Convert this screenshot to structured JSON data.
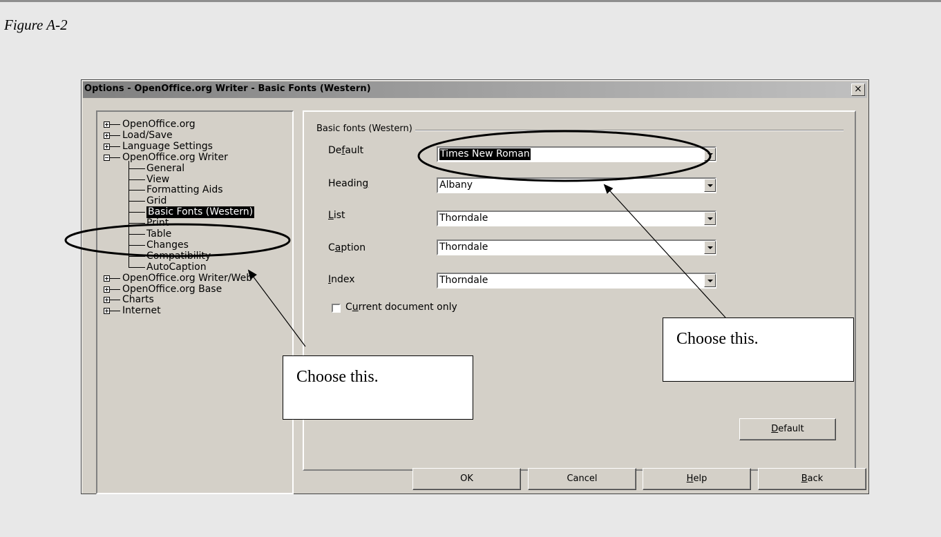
{
  "figure_caption": "Figure A-2",
  "dialog": {
    "title": "Options - OpenOffice.org Writer - Basic Fonts (Western)",
    "close_glyph": "×"
  },
  "tree": {
    "items": [
      {
        "label": "OpenOffice.org",
        "expander": "plus"
      },
      {
        "label": "Load/Save",
        "expander": "plus"
      },
      {
        "label": "Language Settings",
        "expander": "plus"
      },
      {
        "label": "OpenOffice.org Writer",
        "expander": "minus"
      },
      {
        "label": "General"
      },
      {
        "label": "View"
      },
      {
        "label": "Formatting Aids"
      },
      {
        "label": "Grid"
      },
      {
        "label": "Basic Fonts (Western)",
        "selected": true
      },
      {
        "label": "Print"
      },
      {
        "label": "Table"
      },
      {
        "label": "Changes"
      },
      {
        "label": "Compatibility"
      },
      {
        "label": "AutoCaption"
      },
      {
        "label": "OpenOffice.org Writer/Web",
        "expander": "plus"
      },
      {
        "label": "OpenOffice.org Base",
        "expander": "plus"
      },
      {
        "label": "Charts",
        "expander": "plus"
      },
      {
        "label": "Internet",
        "expander": "plus"
      }
    ]
  },
  "panel": {
    "group_title": "Basic fonts (Western)",
    "fields": [
      {
        "label_pre": "De",
        "label_ul": "f",
        "label_post": "ault",
        "value": "Times New Roman",
        "highlighted": true
      },
      {
        "label_pre": "Headin",
        "label_ul": "g",
        "label_post": "",
        "value": "Albany"
      },
      {
        "label_pre": "",
        "label_ul": "L",
        "label_post": "ist",
        "value": "Thorndale"
      },
      {
        "label_pre": "C",
        "label_ul": "a",
        "label_post": "ption",
        "value": "Thorndale"
      },
      {
        "label_pre": "",
        "label_ul": "I",
        "label_post": "ndex",
        "value": "Thorndale"
      }
    ],
    "checkbox": {
      "pre": "C",
      "ul": "u",
      "post": "rrent document only",
      "checked": false
    },
    "default_button": {
      "ul": "D",
      "post": "efault"
    }
  },
  "buttons": {
    "ok": "OK",
    "cancel": "Cancel",
    "help_ul": "H",
    "help_post": "elp",
    "back_ul": "B",
    "back_post": "ack"
  },
  "callouts": {
    "left": "Choose this.",
    "right": "Choose this."
  }
}
